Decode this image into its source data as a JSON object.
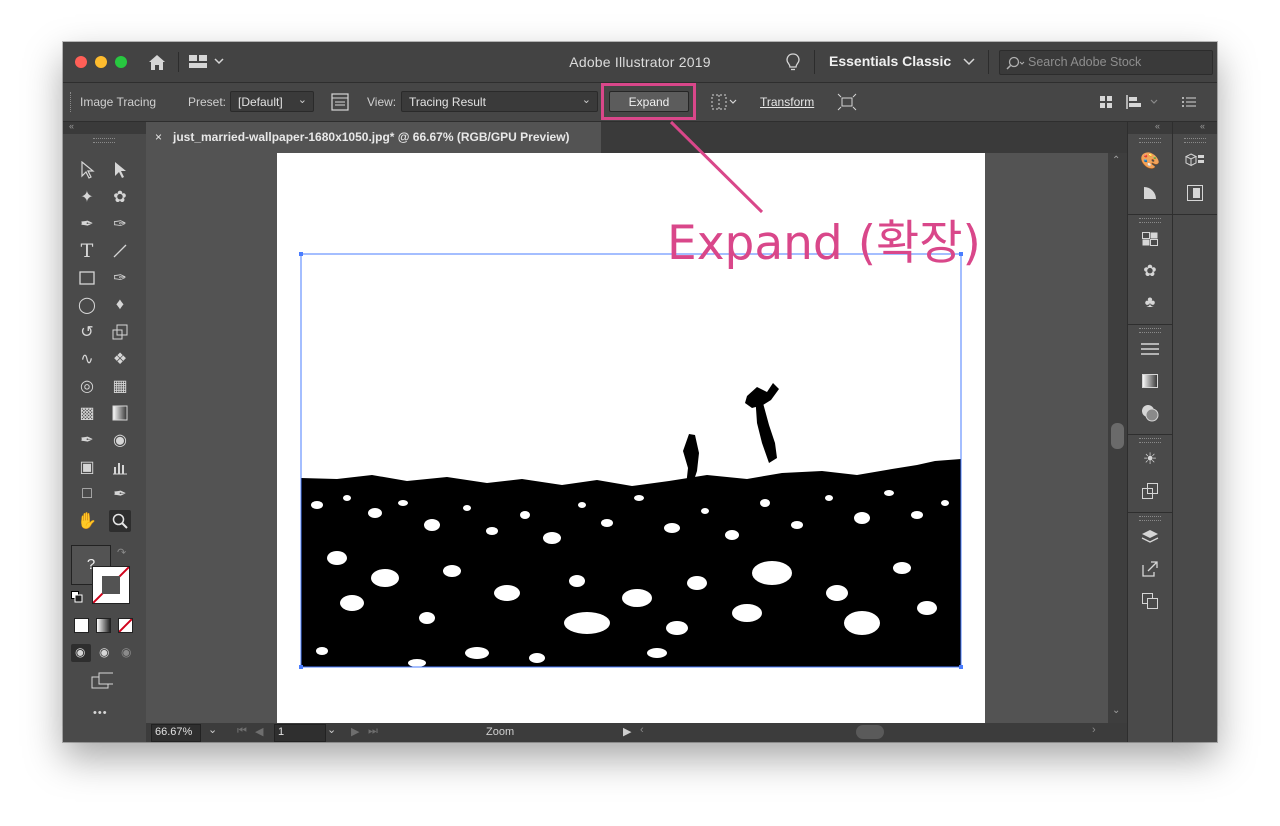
{
  "window": {
    "title": "Adobe Illustrator 2019",
    "workspace": "Essentials Classic",
    "search_placeholder": "Search Adobe Stock"
  },
  "control_bar": {
    "panel_label": "Image Tracing",
    "preset_label": "Preset:",
    "preset_value": "[Default]",
    "view_label": "View:",
    "view_value": "Tracing Result",
    "expand_label": "Expand",
    "transform_label": "Transform"
  },
  "document_tab": {
    "close": "×",
    "title": "just_married-wallpaper-1680x1050.jpg* @ 66.67% (RGB/GPU Preview)"
  },
  "status_bar": {
    "zoom_value": "66.67%",
    "artboard_number": "1",
    "status_text": "Zoom"
  },
  "fill_stroke": {
    "unknown_fill": "?"
  },
  "annotation": {
    "text": "Expand (확장)",
    "color": "#d9478a"
  },
  "toolbar": {
    "more_label": "•••"
  },
  "colors": {
    "accent": "#d9478a",
    "selection": "#4a7dff",
    "traffic_red": "#ff5f57",
    "traffic_yellow": "#febc2e",
    "traffic_green": "#28c840"
  }
}
